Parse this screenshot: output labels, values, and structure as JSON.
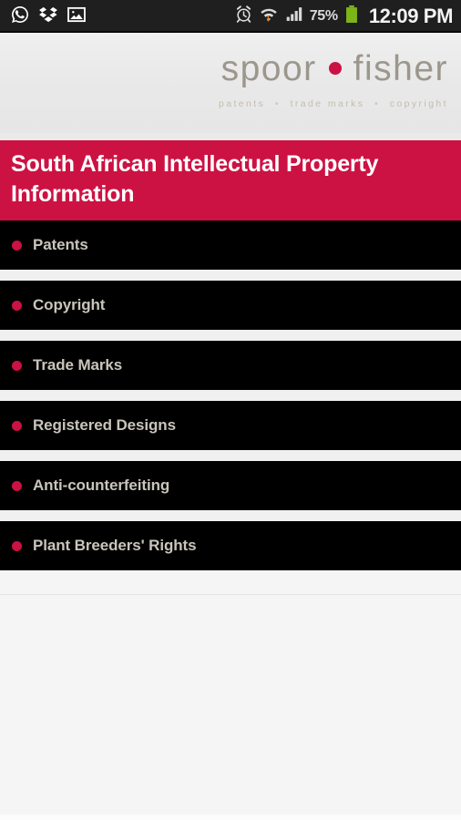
{
  "status_bar": {
    "notification_icons": [
      {
        "name": "whatsapp-icon",
        "label": "WhatsApp"
      },
      {
        "name": "dropbox-icon",
        "label": "Dropbox"
      },
      {
        "name": "gallery-icon",
        "label": "Gallery"
      }
    ],
    "system_icons": [
      {
        "name": "alarm-clock-icon",
        "label": "Alarm"
      },
      {
        "name": "wifi-icon",
        "label": "Wi-Fi"
      },
      {
        "name": "signal-bars-icon",
        "label": "Signal"
      }
    ],
    "battery_percent": "75%",
    "battery_color": "#7cb518",
    "clock": "12:09 PM"
  },
  "logo": {
    "word_one": "spoor",
    "word_two": "fisher",
    "dot_color": "#cc1143",
    "text_color": "#9c978d",
    "tagline_parts": [
      "patents",
      "trade marks",
      "copyright"
    ],
    "tagline_separator": "•"
  },
  "banner": {
    "title": "South African Intellectual Property Information",
    "background": "#cc1243",
    "text_color": "#ffffff"
  },
  "list": {
    "items": [
      {
        "label": "Patents"
      },
      {
        "label": "Copyright"
      },
      {
        "label": "Trade Marks"
      },
      {
        "label": "Registered Designs"
      },
      {
        "label": "Anti-counterfeiting"
      },
      {
        "label": "Plant Breeders' Rights"
      }
    ],
    "bullet_color": "#cc1143",
    "row_background": "#000000",
    "label_color": "#c9c5bb"
  }
}
